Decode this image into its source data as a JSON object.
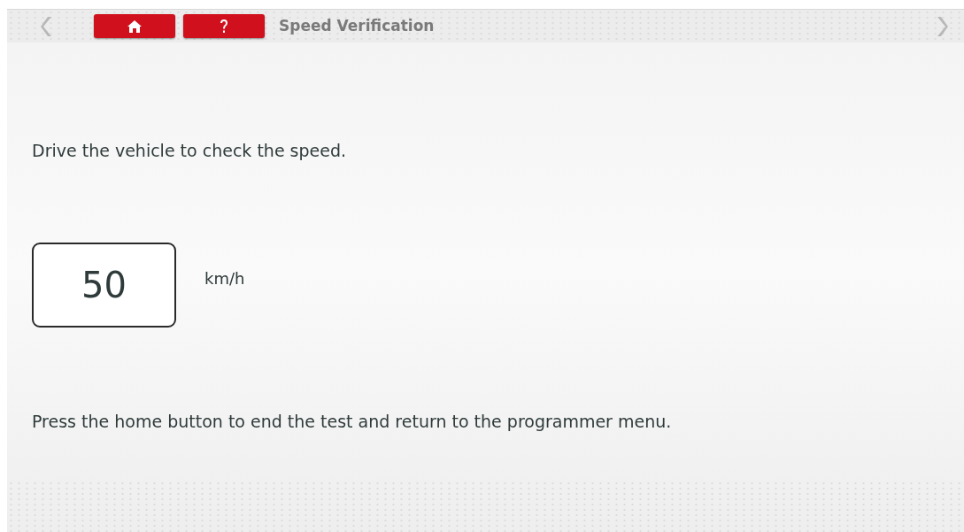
{
  "header": {
    "title": "Speed Verification"
  },
  "instruction": "Drive the vehicle to check the speed.",
  "speed": {
    "value": "50",
    "unit": "km/h"
  },
  "footer_note": "Press the home button to end the test and return to the programmer menu."
}
